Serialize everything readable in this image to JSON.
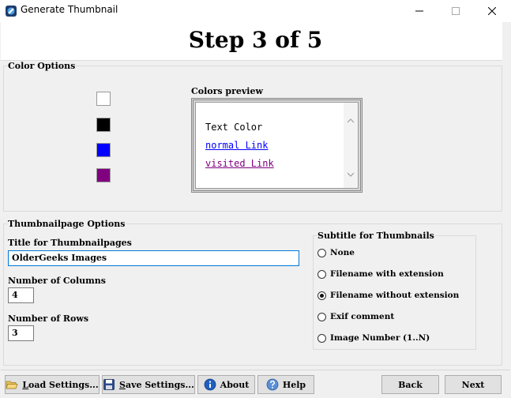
{
  "window": {
    "title": "Generate Thumbnail",
    "controls": {
      "minimize": "—",
      "maximize": "☐",
      "close": "✕"
    }
  },
  "header": {
    "step_title": "Step 3 of 5"
  },
  "color_options": {
    "legend": "Color Options",
    "swatches": [
      {
        "name": "background",
        "color": "#ffffff"
      },
      {
        "name": "text",
        "color": "#000000"
      },
      {
        "name": "link",
        "color": "#0000ff"
      },
      {
        "name": "visited",
        "color": "#800080"
      }
    ],
    "preview_label": "Colors preview",
    "preview": {
      "text": "Text Color",
      "normal_link": "normal Link",
      "visited_link": "visited Link",
      "text_color": "#000000",
      "link_color": "#0000ff",
      "visited_color": "#800080"
    }
  },
  "thumbnail_options": {
    "legend": "Thumbnailpage Options",
    "title_label": "Title for Thumbnailpages",
    "title_value": "OlderGeeks Images",
    "columns_label": "Number of Columns",
    "columns_value": "4",
    "rows_label": "Number of Rows",
    "rows_value": "3",
    "subtitle_legend": "Subtitle for Thumbnails",
    "subtitle_options": [
      {
        "label": "None",
        "selected": false
      },
      {
        "label": "Filename with extension",
        "selected": false
      },
      {
        "label": "Filename without extension",
        "selected": true
      },
      {
        "label": "Exif comment",
        "selected": false
      },
      {
        "label": "Image Number (1..N)",
        "selected": false
      }
    ]
  },
  "buttons": {
    "load_first": "L",
    "load_rest": "oad Settings...",
    "save_first": "S",
    "save_rest": "ave Settings...",
    "about": "About",
    "help": "Help",
    "back": "Back",
    "next": "Next"
  },
  "accent": "#0078d7"
}
